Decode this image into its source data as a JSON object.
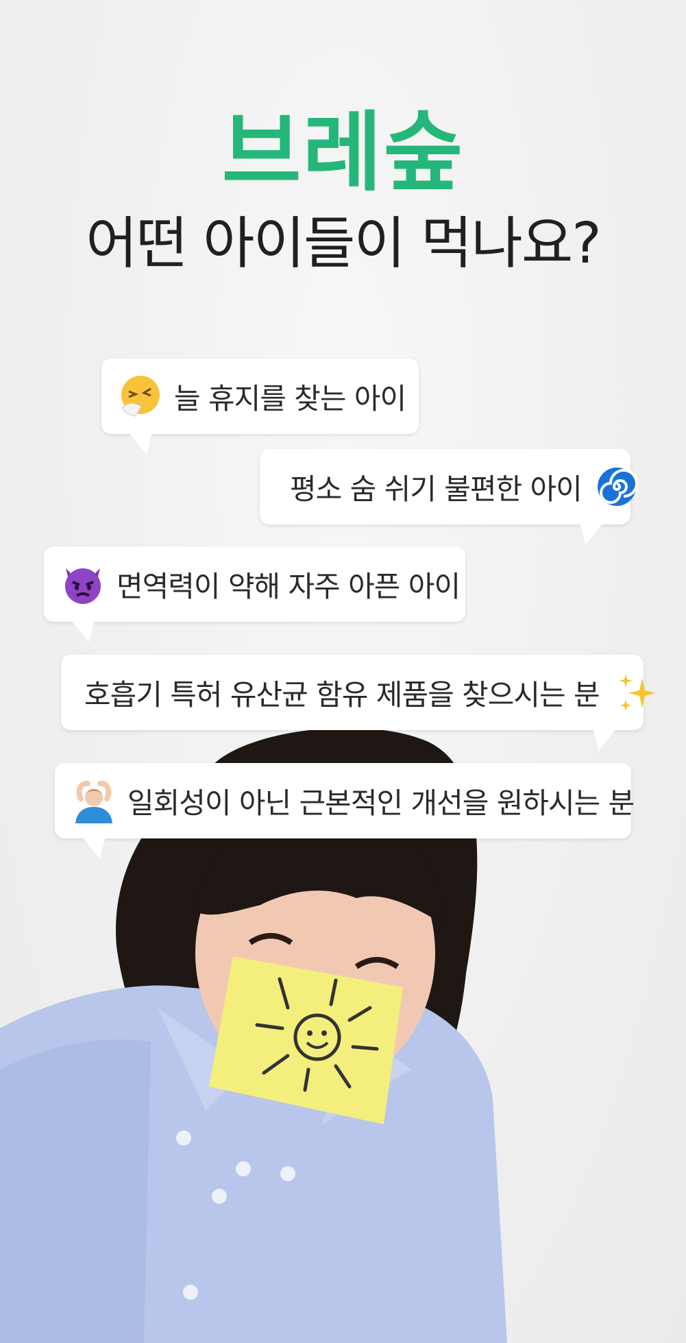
{
  "brand": "브레숲",
  "headline": "어떤 아이들이 먹나요?",
  "bubbles": [
    {
      "text": "늘 휴지를 찾는 아이",
      "emoji": "sneezing-face-icon"
    },
    {
      "text": "평소 숨 쉬기 불편한 아이",
      "emoji": "cyclone-icon"
    },
    {
      "text": "면역력이 약해 자주 아픈 아이",
      "emoji": "angry-devil-icon"
    },
    {
      "text": "호흡기 특허 유산균 함유 제품을 찾으시는 분",
      "emoji": "sparkles-icon"
    },
    {
      "text": "일회성이 아닌 근본적인 개선을 원하시는 분",
      "emoji": "person-gesturing-ok-icon"
    }
  ],
  "colors": {
    "brand": "#25b77a",
    "text": "#231f1f",
    "background": "#f2f2f2"
  }
}
